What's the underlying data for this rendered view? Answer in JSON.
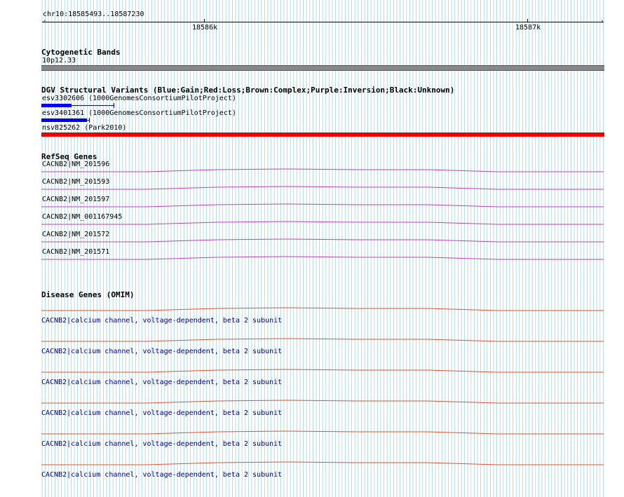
{
  "ruler": {
    "position": "chr10:18585493..18587230",
    "ticks": [
      "18586k",
      "18587k"
    ]
  },
  "cytoband": {
    "title": "Cytogenetic Bands",
    "band": "10p12.33",
    "color": "#888888"
  },
  "dgv": {
    "title": "DGV Structural Variants (Blue:Gain;Red:Loss;Brown:Complex;Purple:Inversion;Black:Unknown)",
    "items": [
      {
        "label": "esv3302606 (1000GenomesConsortiumPilotProject)",
        "color": "#0000ee"
      },
      {
        "label": "esv3401361 (1000GenomesConsortiumPilotProject)",
        "color": "#0000ee"
      },
      {
        "label": "nsv825262 (Park2010)",
        "color": "#ee0000"
      }
    ]
  },
  "refseq": {
    "title": "RefSeq Genes",
    "color": "#bb44bb",
    "genes": [
      {
        "label": "CACNB2|NM_201596"
      },
      {
        "label": "CACNB2|NM_201593"
      },
      {
        "label": "CACNB2|NM_201597"
      },
      {
        "label": "CACNB2|NM_001167945"
      },
      {
        "label": "CACNB2|NM_201572"
      },
      {
        "label": "CACNB2|NM_201571"
      }
    ]
  },
  "omim": {
    "title": "Disease Genes (OMIM)",
    "color": "#dd5533",
    "genes": [
      {
        "label": "CACNB2|calcium channel, voltage-dependent, beta 2 subunit"
      },
      {
        "label": "CACNB2|calcium channel, voltage-dependent, beta 2 subunit"
      },
      {
        "label": "CACNB2|calcium channel, voltage-dependent, beta 2 subunit"
      },
      {
        "label": "CACNB2|calcium channel, voltage-dependent, beta 2 subunit"
      },
      {
        "label": "CACNB2|calcium channel, voltage-dependent, beta 2 subunit"
      },
      {
        "label": "CACNB2|calcium channel, voltage-dependent, beta 2 subunit"
      }
    ]
  },
  "colors": {
    "grid": "#9fd3df",
    "gain": "#0000ee",
    "loss": "#ee0000",
    "link": "#00008b"
  }
}
